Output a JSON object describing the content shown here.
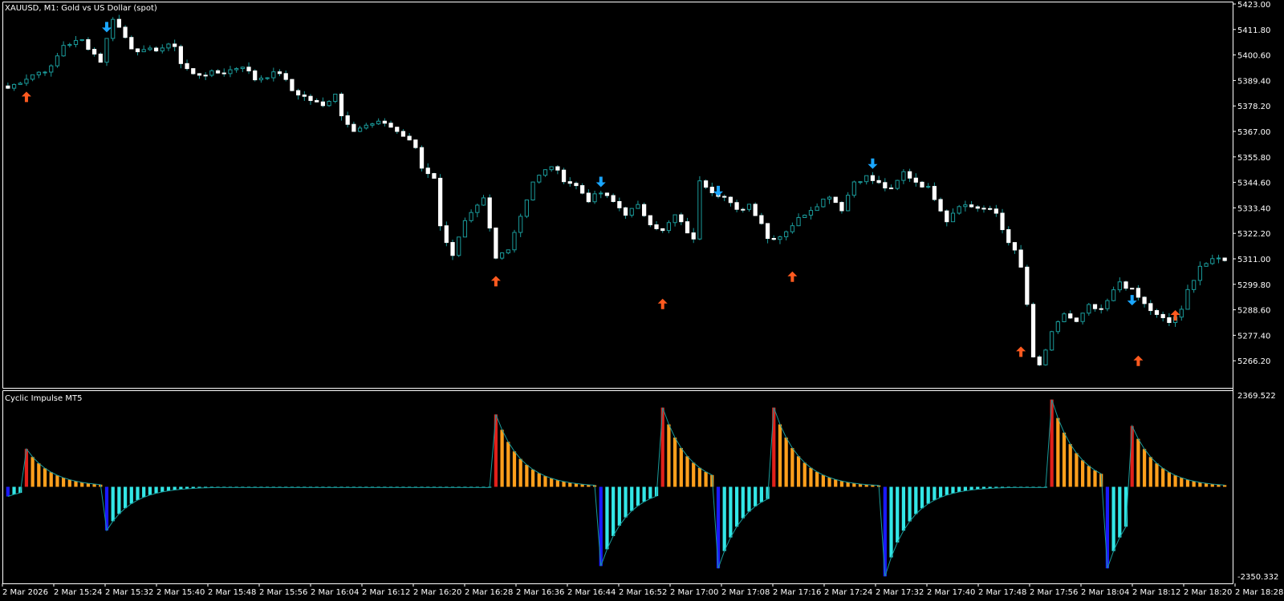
{
  "window": {
    "title": "XAUUSD, M1:  Gold vs US Dollar (spot)",
    "indicator_title": "Cyclic Impulse MT5"
  },
  "colors": {
    "background": "#000000",
    "text": "#ffffff",
    "candle_bull": "#1a9a9a",
    "candle_bear": "#ffffff",
    "arrow_up": "#ff5a1f",
    "arrow_down": "#1aa6ff",
    "osc_strong_up": "#e0201a",
    "osc_up": "#ff9f1c",
    "osc_down": "#33e6e6",
    "osc_strong_down": "#1a1aff",
    "osc_envelope": "#1a9a9a"
  },
  "chart_data": [
    {
      "type": "candlestick",
      "title": "XAUUSD, M1:  Gold vs US Dollar (spot)",
      "ylim": [
        5255.0,
        5423.0
      ],
      "y_ticks": [
        "5423.00",
        "5411.80",
        "5400.60",
        "5389.40",
        "5378.20",
        "5367.00",
        "5355.80",
        "5344.60",
        "5333.40",
        "5322.20",
        "5311.00",
        "5299.80",
        "5288.60",
        "5277.40",
        "5266.20"
      ],
      "x_labels": [
        "2 Mar 2026",
        "2 Mar 15:24",
        "2 Mar 15:32",
        "2 Mar 15:40",
        "2 Mar 15:48",
        "2 Mar 15:56",
        "2 Mar 16:04",
        "2 Mar 16:12",
        "2 Mar 16:20",
        "2 Mar 16:28",
        "2 Mar 16:36",
        "2 Mar 16:44",
        "2 Mar 16:52",
        "2 Mar 17:00",
        "2 Mar 17:08",
        "2 Mar 17:16",
        "2 Mar 17:24",
        "2 Mar 17:32",
        "2 Mar 17:40",
        "2 Mar 17:48",
        "2 Mar 17:56",
        "2 Mar 18:04",
        "2 Mar 18:12",
        "2 Mar 18:20",
        "2 Mar 18:28"
      ],
      "close_path": [
        [
          0,
          5386
        ],
        [
          4,
          5392
        ],
        [
          7,
          5395
        ],
        [
          9,
          5405
        ],
        [
          12,
          5407
        ],
        [
          15,
          5398
        ],
        [
          17,
          5417
        ],
        [
          20,
          5404
        ],
        [
          22,
          5402
        ],
        [
          27,
          5405
        ],
        [
          28,
          5397
        ],
        [
          30,
          5392
        ],
        [
          35,
          5393
        ],
        [
          38,
          5396
        ],
        [
          40,
          5390
        ],
        [
          44,
          5393
        ],
        [
          46,
          5385
        ],
        [
          51,
          5378
        ],
        [
          53,
          5384
        ],
        [
          54,
          5374
        ],
        [
          56,
          5368
        ],
        [
          59,
          5370
        ],
        [
          61,
          5371
        ],
        [
          64,
          5365
        ],
        [
          66,
          5360
        ],
        [
          67,
          5351
        ],
        [
          69,
          5347
        ],
        [
          70,
          5325
        ],
        [
          72,
          5313
        ],
        [
          74,
          5327
        ],
        [
          77,
          5337
        ],
        [
          78,
          5324
        ],
        [
          79,
          5311
        ],
        [
          81,
          5316
        ],
        [
          83,
          5330
        ],
        [
          85,
          5345
        ],
        [
          88,
          5352
        ],
        [
          90,
          5346
        ],
        [
          92,
          5343
        ],
        [
          94,
          5337
        ],
        [
          96,
          5340
        ],
        [
          98,
          5336
        ],
        [
          100,
          5331
        ],
        [
          102,
          5334
        ],
        [
          104,
          5327
        ],
        [
          106,
          5323
        ],
        [
          108,
          5330
        ],
        [
          110,
          5323
        ],
        [
          111,
          5319
        ],
        [
          112,
          5346
        ],
        [
          114,
          5341
        ],
        [
          116,
          5338
        ],
        [
          118,
          5332
        ],
        [
          120,
          5335
        ],
        [
          122,
          5327
        ],
        [
          123,
          5320
        ],
        [
          125,
          5321
        ],
        [
          127,
          5326
        ],
        [
          129,
          5331
        ],
        [
          131,
          5335
        ],
        [
          133,
          5339
        ],
        [
          135,
          5333
        ],
        [
          137,
          5345
        ],
        [
          139,
          5347
        ],
        [
          141,
          5344
        ],
        [
          143,
          5341
        ],
        [
          145,
          5349
        ],
        [
          147,
          5345
        ],
        [
          149,
          5342
        ],
        [
          150,
          5338
        ],
        [
          152,
          5328
        ],
        [
          154,
          5335
        ],
        [
          156,
          5334
        ],
        [
          158,
          5333
        ],
        [
          160,
          5331
        ],
        [
          161,
          5324
        ],
        [
          163,
          5314
        ],
        [
          164,
          5307
        ],
        [
          165,
          5291
        ],
        [
          166,
          5267
        ],
        [
          167,
          5264
        ],
        [
          169,
          5278
        ],
        [
          171,
          5287
        ],
        [
          173,
          5283
        ],
        [
          175,
          5290
        ],
        [
          177,
          5288
        ],
        [
          180,
          5301
        ],
        [
          182,
          5297
        ],
        [
          184,
          5291
        ],
        [
          186,
          5286
        ],
        [
          188,
          5283
        ],
        [
          190,
          5288
        ],
        [
          191,
          5297
        ],
        [
          193,
          5308
        ],
        [
          196,
          5311
        ]
      ],
      "arrows_up_at": [
        [
          3,
          5382
        ],
        [
          79,
          5301
        ],
        [
          106,
          5291
        ],
        [
          127,
          5303
        ],
        [
          164,
          5270
        ],
        [
          183,
          5266
        ],
        [
          189,
          5286
        ]
      ],
      "arrows_down_at": [
        [
          16,
          5413
        ],
        [
          96,
          5345
        ],
        [
          115,
          5341
        ],
        [
          140,
          5353
        ],
        [
          182,
          5293
        ]
      ]
    },
    {
      "type": "histogram",
      "title": "Cyclic Impulse MT5",
      "ylim": [
        -2350.332,
        2369.522
      ],
      "y_tick_labels": [
        "2369.522",
        "-2350.332"
      ],
      "impulses": [
        {
          "start": 0,
          "peak": -420,
          "kind": "down_tail"
        },
        {
          "start": 3,
          "peak": 1650,
          "kind": "up"
        },
        {
          "start": 16,
          "peak": -1900,
          "kind": "down"
        },
        {
          "start": 79,
          "peak": 3150,
          "kind": "up"
        },
        {
          "start": 96,
          "peak": -3450,
          "kind": "down"
        },
        {
          "start": 106,
          "peak": 3450,
          "kind": "up"
        },
        {
          "start": 115,
          "peak": -3550,
          "kind": "down"
        },
        {
          "start": 124,
          "peak": 3450,
          "kind": "up"
        },
        {
          "start": 142,
          "peak": -3900,
          "kind": "down"
        },
        {
          "start": 169,
          "peak": 3800,
          "kind": "up"
        },
        {
          "start": 178,
          "peak": -3550,
          "kind": "down"
        },
        {
          "start": 182,
          "peak": 2650,
          "kind": "up"
        }
      ]
    }
  ]
}
